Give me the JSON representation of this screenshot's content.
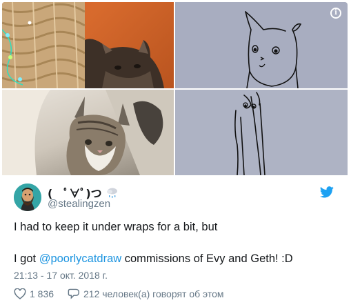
{
  "media": {
    "info_label": "i"
  },
  "author": {
    "display_name": "(　ﾟ∀ﾟ)つ",
    "handle": "@stealingzen"
  },
  "tweet": {
    "line1": "I had to keep it under wraps for a bit, but",
    "line2_prefix": "I got ",
    "mention": "@poorlycatdraw",
    "line2_suffix": " commissions of Evy and Geth! :D",
    "timestamp": "21:13 - 17 окт. 2018 г."
  },
  "actions": {
    "likes": "1 836",
    "replies_text": "212 человек(а) говорят об этом"
  },
  "colors": {
    "link": "#1c94e0",
    "muted": "#657786",
    "text": "#14171a",
    "twitter_blue": "#1da1f2"
  },
  "icons": {
    "info": "info-icon",
    "bird": "twitter-bird-icon",
    "heart": "heart-icon",
    "reply": "reply-bubble-icon",
    "cloud": "rain-cloud-icon"
  }
}
